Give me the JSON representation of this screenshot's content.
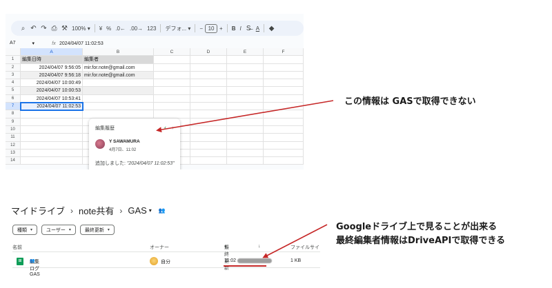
{
  "sheet": {
    "toolbar": {
      "zoom": "100%",
      "currency": "¥",
      "percent": "%",
      "dec_decrease": ".0←",
      "dec_increase": ".00→",
      "format_123": "123",
      "font": "デフォ...",
      "font_size": "10",
      "bold": "B",
      "italic": "I",
      "text_color": "A"
    },
    "name_box": "A7",
    "formula_value": "2024/04/07 11:02:53",
    "columns": [
      "A",
      "B",
      "C",
      "D",
      "E",
      "F"
    ],
    "rows": [
      {
        "n": "1",
        "a": "編集日時",
        "b": "編集者"
      },
      {
        "n": "2",
        "a": "2024/04/07 9:56:05",
        "b": "mir.for.note@gmail.com"
      },
      {
        "n": "3",
        "a": "2024/04/07 9:56:18",
        "b": "mir.for.note@gmail.com"
      },
      {
        "n": "4",
        "a": "2024/04/07 10:00:49",
        "b": ""
      },
      {
        "n": "5",
        "a": "2024/04/07 10:00:53",
        "b": ""
      },
      {
        "n": "6",
        "a": "2024/04/07 10:53:41",
        "b": ""
      },
      {
        "n": "7",
        "a": "2024/04/07 11:02:53",
        "b": ""
      },
      {
        "n": "8",
        "a": "",
        "b": ""
      },
      {
        "n": "9",
        "a": "",
        "b": ""
      },
      {
        "n": "10",
        "a": "",
        "b": ""
      },
      {
        "n": "11",
        "a": "",
        "b": ""
      },
      {
        "n": "12",
        "a": "",
        "b": ""
      },
      {
        "n": "13",
        "a": "",
        "b": ""
      },
      {
        "n": "14",
        "a": "",
        "b": ""
      }
    ],
    "history_card": {
      "title": "編集履歴",
      "user": "Y SAWAMURA",
      "date": "4月7日、11:02",
      "action": "追加しました: ",
      "value": "\"2024/04/07 11:02:53\""
    }
  },
  "drive": {
    "breadcrumb": [
      "マイドライブ",
      "note共有",
      "GAS"
    ],
    "filters": [
      "種類",
      "ユーザー",
      "最終更新"
    ],
    "columns": {
      "name": "名前",
      "owner": "オーナー",
      "modified": "最終更新",
      "size": "ファイルサイ"
    },
    "file": {
      "name": "編集ログGAS",
      "owner": "自分",
      "modified": "11:02",
      "size": "1 KB"
    }
  },
  "annotations": {
    "note1": "この情報は GASで取得できない",
    "note2_line1": "Googleドライブ上で見ることが出来る",
    "note2_line2": "最終編集者情報はDriveAPIで取得できる",
    "color": "#c62828"
  }
}
